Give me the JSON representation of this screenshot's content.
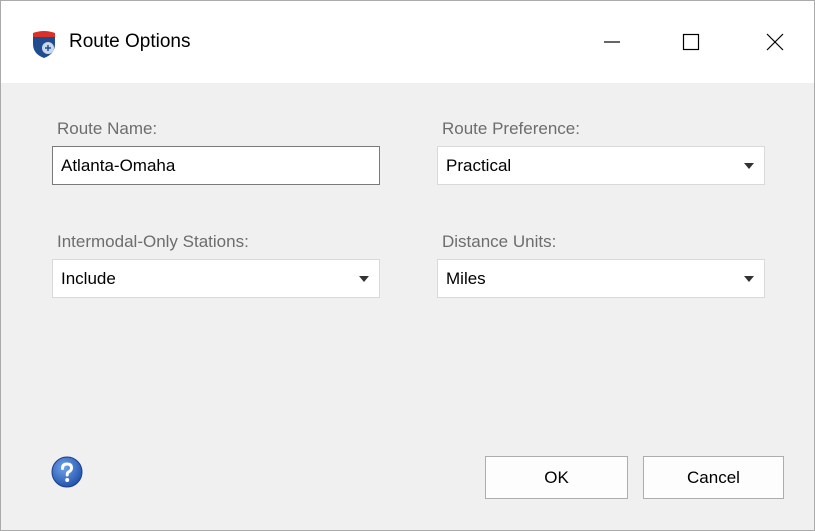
{
  "window": {
    "title": "Route Options",
    "icons": {
      "app": "route-shield-icon",
      "minimize": "minimize-icon",
      "maximize": "maximize-icon",
      "close": "close-icon",
      "help": "help-icon"
    }
  },
  "form": {
    "route_name": {
      "label": "Route Name:",
      "value": "Atlanta-Omaha"
    },
    "route_preference": {
      "label": "Route Preference:",
      "selected": "Practical"
    },
    "intermodal_only_stations": {
      "label": "Intermodal-Only Stations:",
      "selected": "Include"
    },
    "distance_units": {
      "label": "Distance Units:",
      "selected": "Miles"
    }
  },
  "buttons": {
    "ok": "OK",
    "cancel": "Cancel"
  },
  "colors": {
    "dialog_background": "#f0f0f0",
    "titlebar_background": "#ffffff",
    "label_text": "#6d6d6d",
    "help_icon": "#2a5fb8",
    "shield_blue": "#1f4c8f",
    "shield_red": "#d9322b"
  }
}
